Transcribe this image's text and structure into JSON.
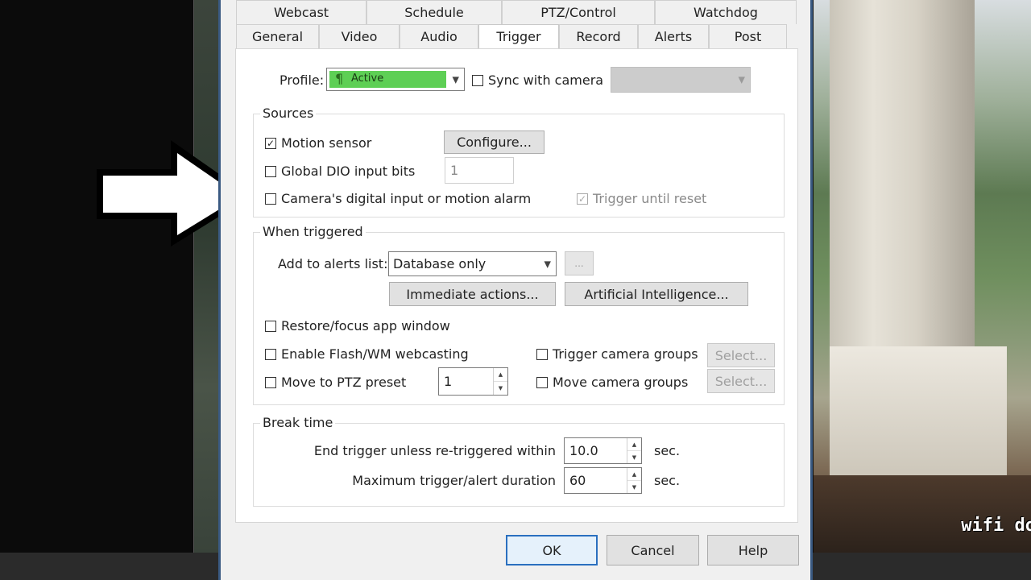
{
  "tabs_row1": [
    "Webcast",
    "Schedule",
    "PTZ/Control",
    "Watchdog"
  ],
  "tabs_row2": [
    "General",
    "Video",
    "Audio",
    "Trigger",
    "Record",
    "Alerts",
    "Post"
  ],
  "active_tab": "Trigger",
  "profile": {
    "label": "Profile:",
    "value": "Active",
    "value_color": "#5ecf55",
    "sync_label": "Sync with camera"
  },
  "sources": {
    "title": "Sources",
    "motion_sensor": "Motion sensor",
    "configure_button": "Configure...",
    "global_dio": "Global DIO input bits",
    "global_dio_value": "1",
    "camera_input": "Camera's digital input or motion alarm",
    "trigger_until_reset": "Trigger until reset"
  },
  "when_triggered": {
    "title": "When triggered",
    "alerts_label": "Add to alerts list:",
    "alerts_value": "Database only",
    "more_button": "...",
    "immediate_button": "Immediate actions...",
    "ai_button": "Artificial Intelligence...",
    "restore_focus": "Restore/focus app window",
    "flash_webcasting": "Enable Flash/WM webcasting",
    "trigger_groups": "Trigger camera groups",
    "select_button_1": "Select...",
    "ptz_preset": "Move to PTZ preset",
    "ptz_value": "1",
    "move_groups": "Move camera groups",
    "select_button_2": "Select..."
  },
  "break_time": {
    "title": "Break time",
    "end_trigger_label": "End trigger unless re-triggered within",
    "end_trigger_value": "10.0",
    "end_trigger_unit": "sec.",
    "max_duration_label": "Maximum trigger/alert duration",
    "max_duration_value": "60",
    "max_duration_unit": "sec."
  },
  "footer": {
    "ok": "OK",
    "cancel": "Cancel",
    "help": "Help"
  },
  "overlay_text": "wifi do",
  "checkmark": "✓"
}
